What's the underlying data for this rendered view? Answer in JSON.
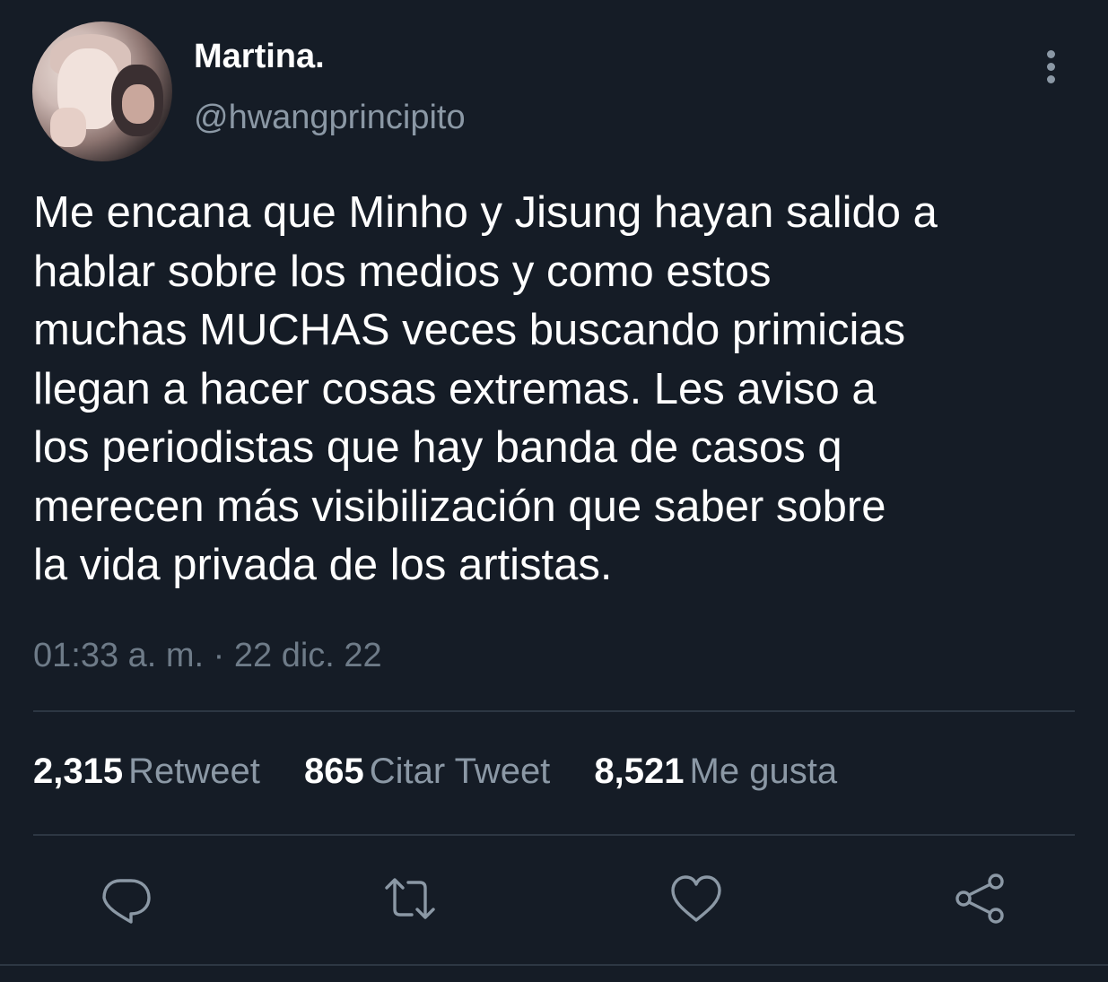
{
  "tweet": {
    "author": {
      "display_name": "Martina.",
      "handle": "@hwangprincipito",
      "avatar_icon": "profile-photo"
    },
    "text_lines": [
      "Me encana que Minho y Jisung hayan salido a",
      "hablar sobre los medios y como estos",
      "muchas MUCHAS veces buscando primicias",
      "llegan a hacer cosas extremas. Les aviso a",
      "los periodistas que hay banda de casos q",
      "merecen más visibilización que saber sobre",
      "la vida privada de los artistas."
    ],
    "timestamp": "01:33 a. m. · 22 dic. 22",
    "stats": {
      "retweets": {
        "count": "2,315",
        "label": "Retweet"
      },
      "quotes": {
        "count": "865",
        "label": "Citar Tweet"
      },
      "likes": {
        "count": "8,521",
        "label": "Me gusta"
      }
    },
    "actions": [
      "reply-icon",
      "retweet-icon",
      "like-icon",
      "share-icon"
    ]
  },
  "colors": {
    "background": "#151c26",
    "primary_text": "#ffffff",
    "secondary_text": "#8b98a5",
    "divider": "#2d3743"
  }
}
